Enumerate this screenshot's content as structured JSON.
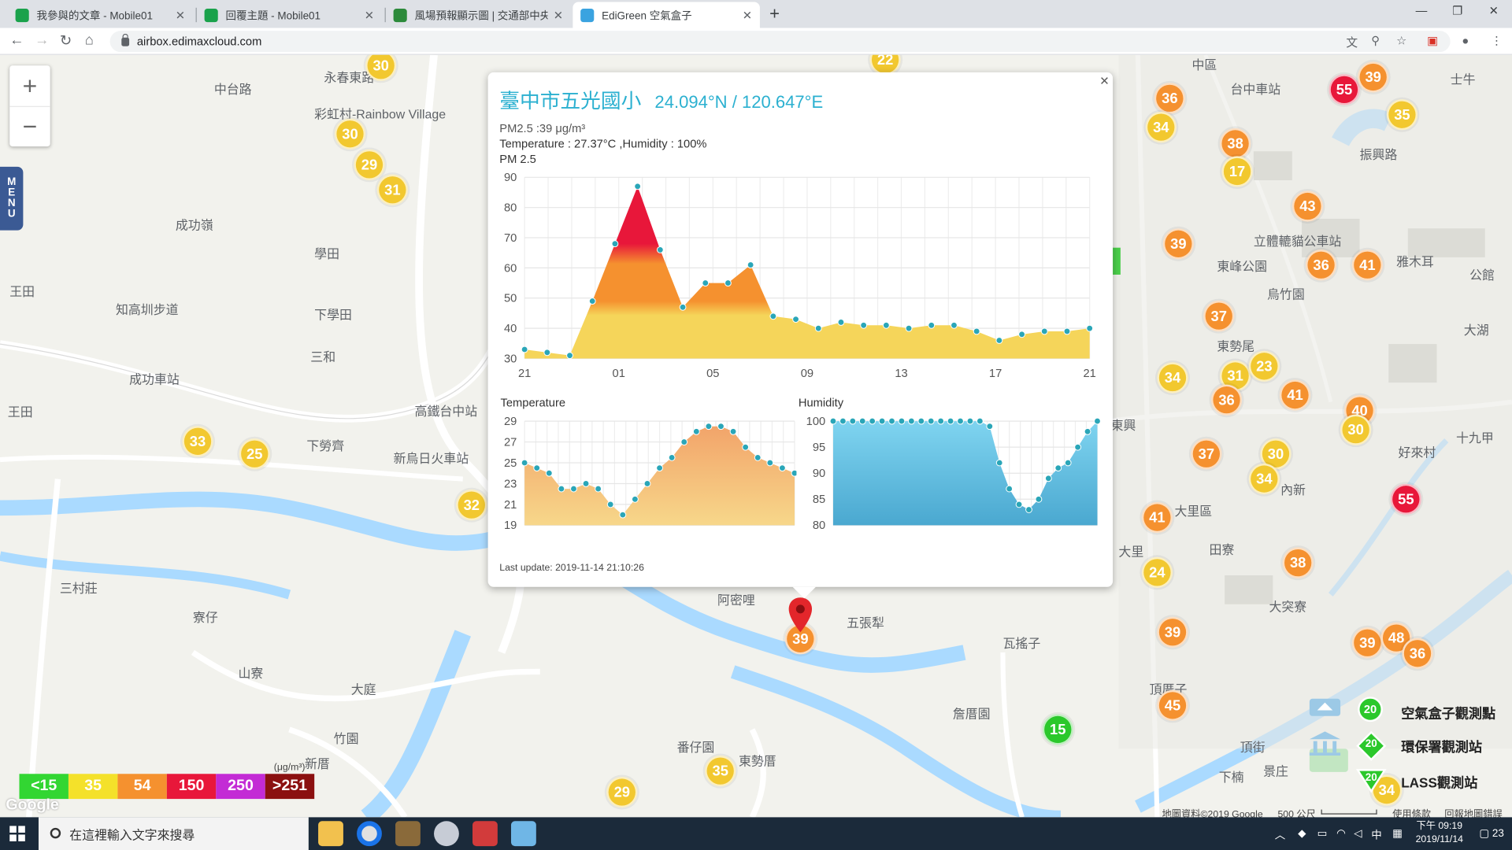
{
  "browser": {
    "tabs": [
      {
        "title": "我參與的文章 - Mobile01",
        "color": "#1aa24b"
      },
      {
        "title": "回覆主題 - Mobile01",
        "color": "#1aa24b"
      },
      {
        "title": "風場預報顯示圖 | 交通部中央氣象",
        "color": "#2c8a3a"
      },
      {
        "title": "EdiGreen 空氣盒子",
        "color": "#3aa3e0"
      }
    ],
    "url": "airbox.edimaxcloud.com"
  },
  "map": {
    "zoom_in": "+",
    "zoom_out": "−",
    "menu_label": [
      "M",
      "E",
      "N",
      "U"
    ],
    "places": [
      {
        "t": "成功嶺",
        "x": 182,
        "y": 223
      },
      {
        "t": "學田",
        "x": 326,
        "y": 253
      },
      {
        "t": "下學田",
        "x": 326,
        "y": 316
      },
      {
        "t": "三和",
        "x": 322,
        "y": 360
      },
      {
        "t": "王田",
        "x": 10,
        "y": 292
      },
      {
        "t": "知高圳步道",
        "x": 120,
        "y": 311
      },
      {
        "t": "成功車站",
        "x": 134,
        "y": 383
      },
      {
        "t": "王田",
        "x": 8,
        "y": 417
      },
      {
        "t": "下勞齊",
        "x": 318,
        "y": 452
      },
      {
        "t": "新烏日火車站",
        "x": 408,
        "y": 465
      },
      {
        "t": "高鐵台中站",
        "x": 430,
        "y": 416
      },
      {
        "t": "彩虹村-Rainbow Village",
        "x": 326,
        "y": 108
      },
      {
        "t": "三村莊",
        "x": 62,
        "y": 600
      },
      {
        "t": "寮仔",
        "x": 200,
        "y": 630
      },
      {
        "t": "山寮",
        "x": 247,
        "y": 688
      },
      {
        "t": "大庭",
        "x": 364,
        "y": 705
      },
      {
        "t": "竹園",
        "x": 346,
        "y": 756
      },
      {
        "t": "新厝",
        "x": 316,
        "y": 782
      },
      {
        "t": "五張犁",
        "x": 878,
        "y": 636
      },
      {
        "t": "阿密哩",
        "x": 744,
        "y": 612
      },
      {
        "t": "瓦搖子",
        "x": 1040,
        "y": 657
      },
      {
        "t": "詹厝園",
        "x": 988,
        "y": 730
      },
      {
        "t": "番仔園",
        "x": 702,
        "y": 765
      },
      {
        "t": "東勢厝",
        "x": 766,
        "y": 779
      },
      {
        "t": "頂街",
        "x": 1286,
        "y": 765
      },
      {
        "t": "下楠",
        "x": 1264,
        "y": 796
      },
      {
        "t": "景庄",
        "x": 1310,
        "y": 790
      },
      {
        "t": "頂厝子",
        "x": 1192,
        "y": 705
      },
      {
        "t": "大突寮",
        "x": 1316,
        "y": 619
      },
      {
        "t": "大里區",
        "x": 1218,
        "y": 520
      },
      {
        "t": "大里",
        "x": 1160,
        "y": 562
      },
      {
        "t": "田寮",
        "x": 1254,
        "y": 560
      },
      {
        "t": "內新",
        "x": 1328,
        "y": 498
      },
      {
        "t": "東興",
        "x": 1152,
        "y": 431
      },
      {
        "t": "東勢尾",
        "x": 1262,
        "y": 349
      },
      {
        "t": "烏竹園",
        "x": 1314,
        "y": 295
      },
      {
        "t": "雅木耳",
        "x": 1448,
        "y": 261
      },
      {
        "t": "公館",
        "x": 1524,
        "y": 275
      },
      {
        "t": "大湖",
        "x": 1518,
        "y": 332
      },
      {
        "t": "好來村",
        "x": 1450,
        "y": 459
      },
      {
        "t": "十九甲",
        "x": 1510,
        "y": 444
      },
      {
        "t": "中區",
        "x": 1236,
        "y": 57
      },
      {
        "t": "士牛",
        "x": 1504,
        "y": 72
      },
      {
        "t": "台中車站",
        "x": 1276,
        "y": 82
      },
      {
        "t": "振興路",
        "x": 1410,
        "y": 150
      },
      {
        "t": "立體轆貓公車站",
        "x": 1300,
        "y": 240
      },
      {
        "t": "東峰公園",
        "x": 1262,
        "y": 266
      },
      {
        "t": "永春東路",
        "x": 336,
        "y": 70
      },
      {
        "t": "中台路",
        "x": 222,
        "y": 82
      }
    ],
    "markers": [
      {
        "v": "30",
        "x": 395,
        "y": 68,
        "c": "#f2c82f"
      },
      {
        "v": "30",
        "x": 363,
        "y": 139,
        "c": "#f2c82f"
      },
      {
        "v": "29",
        "x": 383,
        "y": 171,
        "c": "#f2c82f"
      },
      {
        "v": "31",
        "x": 407,
        "y": 197,
        "c": "#f2c82f"
      },
      {
        "v": "22",
        "x": 918,
        "y": 62,
        "c": "#f2c82f"
      },
      {
        "v": "33",
        "x": 205,
        "y": 458,
        "c": "#f2c82f"
      },
      {
        "v": "25",
        "x": 264,
        "y": 471,
        "c": "#f2c82f"
      },
      {
        "v": "32",
        "x": 489,
        "y": 524,
        "c": "#f2c82f"
      },
      {
        "v": "39",
        "x": 830,
        "y": 663,
        "c": "#f5912f"
      },
      {
        "v": "35",
        "x": 747,
        "y": 800,
        "c": "#f2c82f"
      },
      {
        "v": "29",
        "x": 645,
        "y": 822,
        "c": "#f2c82f"
      },
      {
        "v": "15",
        "x": 1097,
        "y": 757,
        "c": "#2bc82b"
      },
      {
        "v": "36",
        "x": 1213,
        "y": 102,
        "c": "#f5912f"
      },
      {
        "v": "34",
        "x": 1204,
        "y": 132,
        "c": "#f2c82f"
      },
      {
        "v": "55",
        "x": 1394,
        "y": 93,
        "c": "#e8173a"
      },
      {
        "v": "39",
        "x": 1424,
        "y": 80,
        "c": "#f5912f"
      },
      {
        "v": "35",
        "x": 1454,
        "y": 119,
        "c": "#f2c82f"
      },
      {
        "v": "38",
        "x": 1281,
        "y": 149,
        "c": "#f5912f"
      },
      {
        "v": "17",
        "x": 1283,
        "y": 178,
        "c": "#f2c82f"
      },
      {
        "v": "43",
        "x": 1356,
        "y": 214,
        "c": "#f5912f"
      },
      {
        "v": "39",
        "x": 1222,
        "y": 253,
        "c": "#f5912f"
      },
      {
        "v": "36",
        "x": 1370,
        "y": 275,
        "c": "#f5912f"
      },
      {
        "v": "41",
        "x": 1418,
        "y": 275,
        "c": "#f5912f"
      },
      {
        "v": "37",
        "x": 1264,
        "y": 328,
        "c": "#f5912f"
      },
      {
        "v": "34",
        "x": 1216,
        "y": 392,
        "c": "#f2c82f"
      },
      {
        "v": "31",
        "x": 1281,
        "y": 390,
        "c": "#f2c82f"
      },
      {
        "v": "23",
        "x": 1311,
        "y": 380,
        "c": "#f2c82f"
      },
      {
        "v": "36",
        "x": 1272,
        "y": 415,
        "c": "#f5912f"
      },
      {
        "v": "41",
        "x": 1343,
        "y": 410,
        "c": "#f5912f"
      },
      {
        "v": "40",
        "x": 1410,
        "y": 426,
        "c": "#f5912f"
      },
      {
        "v": "30",
        "x": 1406,
        "y": 446,
        "c": "#f2c82f"
      },
      {
        "v": "37",
        "x": 1251,
        "y": 471,
        "c": "#f5912f"
      },
      {
        "v": "30",
        "x": 1323,
        "y": 471,
        "c": "#f2c82f"
      },
      {
        "v": "34",
        "x": 1311,
        "y": 497,
        "c": "#f2c82f"
      },
      {
        "v": "55",
        "x": 1458,
        "y": 518,
        "c": "#e8173a"
      },
      {
        "v": "41",
        "x": 1200,
        "y": 537,
        "c": "#f5912f"
      },
      {
        "v": "24",
        "x": 1200,
        "y": 594,
        "c": "#f2c82f"
      },
      {
        "v": "38",
        "x": 1346,
        "y": 584,
        "c": "#f5912f"
      },
      {
        "v": "39",
        "x": 1216,
        "y": 656,
        "c": "#f5912f"
      },
      {
        "v": "39",
        "x": 1418,
        "y": 667,
        "c": "#f5912f"
      },
      {
        "v": "48",
        "x": 1448,
        "y": 662,
        "c": "#f5912f"
      },
      {
        "v": "36",
        "x": 1470,
        "y": 678,
        "c": "#f5912f"
      },
      {
        "v": "45",
        "x": 1216,
        "y": 732,
        "c": "#f5912f"
      },
      {
        "v": "34",
        "x": 1438,
        "y": 820,
        "c": "#f2c82f"
      }
    ],
    "legend": [
      {
        "t": "<15",
        "c": "#32d632"
      },
      {
        "t": "35",
        "c": "#f4e12a"
      },
      {
        "t": "54",
        "c": "#f5912f"
      },
      {
        "t": "150",
        "c": "#e8173a"
      },
      {
        "t": "250",
        "c": "#c32bd5"
      },
      {
        "t": ">251",
        "c": "#8b1010"
      }
    ],
    "legend_unit": "(μg/m³)",
    "google_logo": "Google",
    "stations": [
      {
        "label": "空氣盒子觀測點",
        "badge": "20"
      },
      {
        "label": "環保署觀測站",
        "badge": "20"
      },
      {
        "label": "LASS觀測站",
        "badge": "20"
      }
    ],
    "footer": {
      "map_data": "地圖資料©2019 Google",
      "scale": "500 公尺",
      "terms": "使用條款",
      "report": "回報地圖錯誤"
    }
  },
  "popup": {
    "title": "臺中市五光國小",
    "coords": "24.094°N / 120.647°E",
    "pm_line": "PM2.5 :39 μg/m³",
    "temp_line": "Temperature : 27.37°C ,Humidity : 100%",
    "pm_label": "PM 2.5",
    "temp_label": "Temperature",
    "hum_label": "Humidity",
    "last_update": "Last update: 2019-11-14 21:10:26",
    "close": "×"
  },
  "chart_data": [
    {
      "type": "area",
      "title": "PM 2.5",
      "x_ticks": [
        "21",
        "01",
        "05",
        "09",
        "13",
        "17",
        "21"
      ],
      "ylim": [
        30,
        90
      ],
      "y_ticks": [
        30,
        40,
        50,
        60,
        70,
        80,
        90
      ],
      "values": [
        33,
        32,
        31,
        49,
        68,
        87,
        66,
        47,
        55,
        55,
        61,
        44,
        43,
        40,
        42,
        41,
        41,
        40,
        41,
        41,
        39,
        36,
        38,
        39,
        39,
        40
      ],
      "bands": {
        "yellow": "#f5d55a",
        "orange": "#f5912f",
        "red": "#e8173a"
      },
      "grid": true
    },
    {
      "type": "area",
      "title": "Temperature",
      "ylim": [
        19,
        29
      ],
      "y_ticks": [
        19,
        21,
        23,
        25,
        27,
        29
      ],
      "values": [
        25,
        24.5,
        24,
        22.5,
        22.5,
        23,
        22.5,
        21,
        20,
        21.5,
        23,
        24.5,
        25.5,
        27,
        28,
        28.5,
        28.5,
        28,
        26.5,
        25.5,
        25,
        24.5,
        24
      ],
      "color": "#f5b67a",
      "grid": true
    },
    {
      "type": "area",
      "title": "Humidity",
      "ylim": [
        80,
        100
      ],
      "y_ticks": [
        80,
        85,
        90,
        95,
        100
      ],
      "values": [
        100,
        100,
        100,
        100,
        100,
        100,
        100,
        100,
        100,
        100,
        100,
        100,
        100,
        100,
        100,
        100,
        99,
        92,
        87,
        84,
        83,
        85,
        89,
        91,
        92,
        95,
        98,
        100
      ],
      "color": "#5bc6e8",
      "grid": true
    }
  ],
  "taskbar": {
    "search_placeholder": "在這裡輸入文字來搜尋",
    "ime": "中",
    "time": "下午 09:19",
    "date": "2019/11/14",
    "notif": "23"
  }
}
